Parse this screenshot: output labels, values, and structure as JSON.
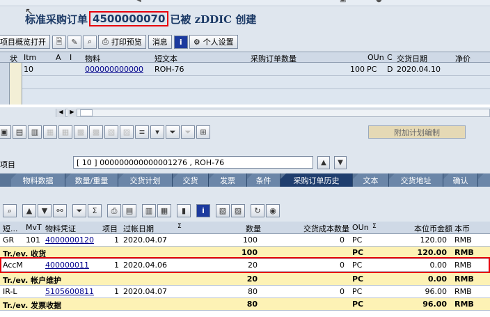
{
  "title": {
    "prefix": "标准采购订单",
    "number": "4500000070",
    "suffix": "已被 zDDIC 创建"
  },
  "toolbar": {
    "overview_btn": "项目概览打开",
    "print_preview": "打印预览",
    "messages": "消息",
    "personal_settings": "个人设置"
  },
  "items_table": {
    "headers": [
      "状",
      "Itm",
      "A",
      "I",
      "物料",
      "短文本",
      "采购订单数量",
      "OUn",
      "C",
      "交货日期",
      "净价"
    ],
    "rows": [
      {
        "itm": "10",
        "material": "000000000000",
        "short_text": "ROH-76",
        "qty": "100",
        "oun": "PC",
        "c": "D",
        "date": "2020.04.10",
        "price": ""
      }
    ]
  },
  "detail": {
    "additional_planning_btn": "附加计划编制",
    "item_label": "项目",
    "item_value": "[ 10 ] 000000000000001276 , ROH-76"
  },
  "tabs": [
    "物料数据",
    "数量/重量",
    "交货计划",
    "交货",
    "发票",
    "条件",
    "采购订单历史",
    "文本",
    "交货地址",
    "确认"
  ],
  "active_tab": "采购订单历史",
  "history": {
    "headers": [
      "短...",
      "MvT",
      "物料凭证",
      "项目",
      "过帐日期",
      "Σ",
      "数量",
      "交货成本数量",
      "OUn",
      "Σ",
      "本位币金额",
      "本币"
    ],
    "rows": [
      {
        "type": "data",
        "short": "GR",
        "mvt": "101",
        "doc": "4000000120",
        "item": "1",
        "date": "2020.04.07",
        "qty": "100",
        "dcqty": "0",
        "oun": "PC",
        "amount": "120.00",
        "cur": "RMB"
      },
      {
        "type": "sum",
        "short": "Tr./ev. 收货",
        "qty": "100",
        "oun": "PC",
        "amount": "120.00",
        "cur": "RMB"
      },
      {
        "type": "data",
        "short": "AccM",
        "mvt": "",
        "doc": "400000011",
        "item": "1",
        "date": "2020.04.06",
        "qty": "20",
        "dcqty": "0",
        "oun": "PC",
        "amount": "0.00",
        "cur": "RMB"
      },
      {
        "type": "sum",
        "short": "Tr./ev. 帐户维护",
        "qty": "20",
        "oun": "PC",
        "amount": "0.00",
        "cur": "RMB"
      },
      {
        "type": "data",
        "short": "IR-L",
        "mvt": "",
        "doc": "5105600811",
        "item": "1",
        "date": "2020.04.07",
        "qty": "80",
        "dcqty": "0",
        "oun": "PC",
        "amount": "96.00",
        "cur": "RMB"
      },
      {
        "type": "sum",
        "short": "Tr./ev. 发票收据",
        "qty": "80",
        "oun": "PC",
        "amount": "96.00",
        "cur": "RMB"
      }
    ]
  },
  "colors": {
    "highlight_border": "#e8000b",
    "sum_row": "#fdf2b5",
    "dark_tab": "#1f3e6e"
  }
}
